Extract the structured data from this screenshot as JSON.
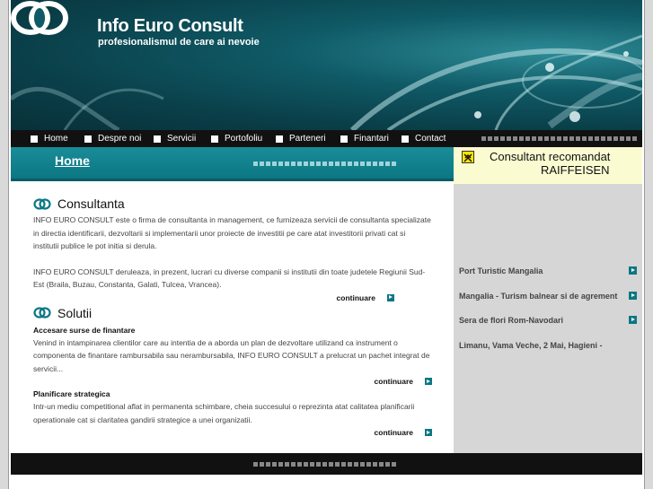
{
  "brand": {
    "title": "Info Euro Consult",
    "subtitle": "profesionalismul de care ai nevoie"
  },
  "nav": {
    "items": [
      {
        "label": "Home"
      },
      {
        "label": "Despre noi"
      },
      {
        "label": "Servicii"
      },
      {
        "label": "Portofoliu"
      },
      {
        "label": "Parteneri"
      },
      {
        "label": "Finantari"
      },
      {
        "label": "Contact"
      }
    ]
  },
  "section": {
    "title": "Home"
  },
  "promo": {
    "line1": "Consultant recomandat",
    "line2": "RAIFFEISEN"
  },
  "sidebar": {
    "links": [
      {
        "label": "Port Turistic Mangalia"
      },
      {
        "label": "Mangalia - Turism balnear si de agrement"
      },
      {
        "label": "Sera de flori Rom-Navodari"
      },
      {
        "label": "Limanu, Vama Veche, 2 Mai, Hagieni -"
      }
    ]
  },
  "consultanta": {
    "heading": "Consultanta",
    "p1": "INFO EURO CONSULT este o firma de consultanta in management, ce furnizeaza servicii de consultanta specializate in directia identificarii, dezvoltarii si implementarii unor proiecte de investitii pe care atat investitorii privati cat si institutii publice le pot initia si derula.",
    "p2": "INFO EURO CONSULT deruleaza, in prezent, lucrari cu diverse companii si institutii din toate judetele Regiunii Sud-Est (Braila, Buzau, Constanta, Galati, Tulcea, Vrancea).",
    "more": "continuare"
  },
  "solutii": {
    "heading": "Solutii",
    "s1_title": "Accesare surse de finantare",
    "s1_text": "Venind in intampinarea clientilor care au intentia de a aborda un plan de dezvoltare utilizand ca instrument o componenta de finantare rambursabila sau nerambursabila, INFO EURO CONSULT a prelucrat un pachet integrat de servicii...",
    "s1_more": "continuare",
    "s2_title": "Planificare strategica",
    "s2_text": "Intr-un mediu competitional aflat in permanenta schimbare, cheia succesului o reprezinta atat calitatea planificarii operationale cat si claritatea gandirii strategice a unei organizatii.",
    "s2_more": "continuare"
  },
  "colors": {
    "teal": "#0b7783",
    "nav_bg": "#111111",
    "promo_bg": "#fbfbd2",
    "sidebar_bg": "#d6d6d6"
  }
}
